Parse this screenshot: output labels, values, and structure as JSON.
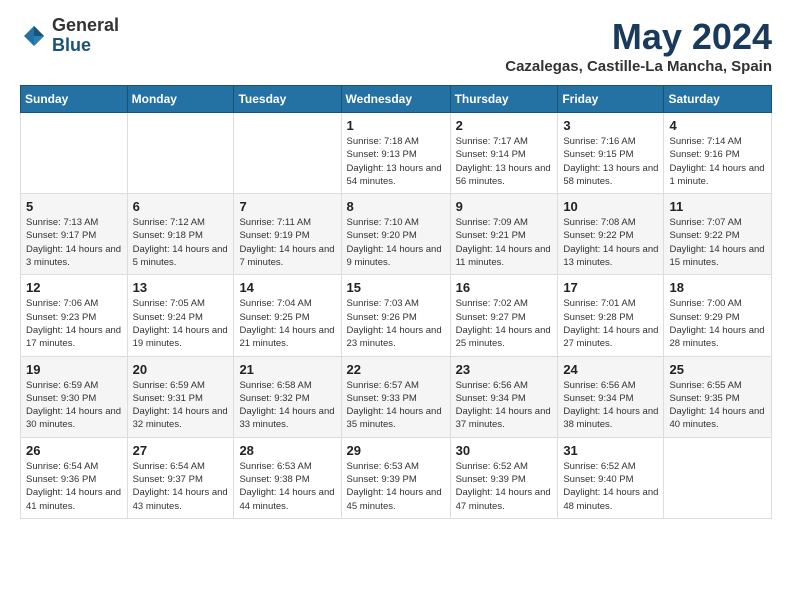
{
  "logo": {
    "general": "General",
    "blue": "Blue"
  },
  "title": "May 2024",
  "subtitle": "Cazalegas, Castille-La Mancha, Spain",
  "days_of_week": [
    "Sunday",
    "Monday",
    "Tuesday",
    "Wednesday",
    "Thursday",
    "Friday",
    "Saturday"
  ],
  "weeks": [
    [
      {
        "day": "",
        "info": ""
      },
      {
        "day": "",
        "info": ""
      },
      {
        "day": "",
        "info": ""
      },
      {
        "day": "1",
        "info": "Sunrise: 7:18 AM\nSunset: 9:13 PM\nDaylight: 13 hours and 54 minutes."
      },
      {
        "day": "2",
        "info": "Sunrise: 7:17 AM\nSunset: 9:14 PM\nDaylight: 13 hours and 56 minutes."
      },
      {
        "day": "3",
        "info": "Sunrise: 7:16 AM\nSunset: 9:15 PM\nDaylight: 13 hours and 58 minutes."
      },
      {
        "day": "4",
        "info": "Sunrise: 7:14 AM\nSunset: 9:16 PM\nDaylight: 14 hours and 1 minute."
      }
    ],
    [
      {
        "day": "5",
        "info": "Sunrise: 7:13 AM\nSunset: 9:17 PM\nDaylight: 14 hours and 3 minutes."
      },
      {
        "day": "6",
        "info": "Sunrise: 7:12 AM\nSunset: 9:18 PM\nDaylight: 14 hours and 5 minutes."
      },
      {
        "day": "7",
        "info": "Sunrise: 7:11 AM\nSunset: 9:19 PM\nDaylight: 14 hours and 7 minutes."
      },
      {
        "day": "8",
        "info": "Sunrise: 7:10 AM\nSunset: 9:20 PM\nDaylight: 14 hours and 9 minutes."
      },
      {
        "day": "9",
        "info": "Sunrise: 7:09 AM\nSunset: 9:21 PM\nDaylight: 14 hours and 11 minutes."
      },
      {
        "day": "10",
        "info": "Sunrise: 7:08 AM\nSunset: 9:22 PM\nDaylight: 14 hours and 13 minutes."
      },
      {
        "day": "11",
        "info": "Sunrise: 7:07 AM\nSunset: 9:22 PM\nDaylight: 14 hours and 15 minutes."
      }
    ],
    [
      {
        "day": "12",
        "info": "Sunrise: 7:06 AM\nSunset: 9:23 PM\nDaylight: 14 hours and 17 minutes."
      },
      {
        "day": "13",
        "info": "Sunrise: 7:05 AM\nSunset: 9:24 PM\nDaylight: 14 hours and 19 minutes."
      },
      {
        "day": "14",
        "info": "Sunrise: 7:04 AM\nSunset: 9:25 PM\nDaylight: 14 hours and 21 minutes."
      },
      {
        "day": "15",
        "info": "Sunrise: 7:03 AM\nSunset: 9:26 PM\nDaylight: 14 hours and 23 minutes."
      },
      {
        "day": "16",
        "info": "Sunrise: 7:02 AM\nSunset: 9:27 PM\nDaylight: 14 hours and 25 minutes."
      },
      {
        "day": "17",
        "info": "Sunrise: 7:01 AM\nSunset: 9:28 PM\nDaylight: 14 hours and 27 minutes."
      },
      {
        "day": "18",
        "info": "Sunrise: 7:00 AM\nSunset: 9:29 PM\nDaylight: 14 hours and 28 minutes."
      }
    ],
    [
      {
        "day": "19",
        "info": "Sunrise: 6:59 AM\nSunset: 9:30 PM\nDaylight: 14 hours and 30 minutes."
      },
      {
        "day": "20",
        "info": "Sunrise: 6:59 AM\nSunset: 9:31 PM\nDaylight: 14 hours and 32 minutes."
      },
      {
        "day": "21",
        "info": "Sunrise: 6:58 AM\nSunset: 9:32 PM\nDaylight: 14 hours and 33 minutes."
      },
      {
        "day": "22",
        "info": "Sunrise: 6:57 AM\nSunset: 9:33 PM\nDaylight: 14 hours and 35 minutes."
      },
      {
        "day": "23",
        "info": "Sunrise: 6:56 AM\nSunset: 9:34 PM\nDaylight: 14 hours and 37 minutes."
      },
      {
        "day": "24",
        "info": "Sunrise: 6:56 AM\nSunset: 9:34 PM\nDaylight: 14 hours and 38 minutes."
      },
      {
        "day": "25",
        "info": "Sunrise: 6:55 AM\nSunset: 9:35 PM\nDaylight: 14 hours and 40 minutes."
      }
    ],
    [
      {
        "day": "26",
        "info": "Sunrise: 6:54 AM\nSunset: 9:36 PM\nDaylight: 14 hours and 41 minutes."
      },
      {
        "day": "27",
        "info": "Sunrise: 6:54 AM\nSunset: 9:37 PM\nDaylight: 14 hours and 43 minutes."
      },
      {
        "day": "28",
        "info": "Sunrise: 6:53 AM\nSunset: 9:38 PM\nDaylight: 14 hours and 44 minutes."
      },
      {
        "day": "29",
        "info": "Sunrise: 6:53 AM\nSunset: 9:39 PM\nDaylight: 14 hours and 45 minutes."
      },
      {
        "day": "30",
        "info": "Sunrise: 6:52 AM\nSunset: 9:39 PM\nDaylight: 14 hours and 47 minutes."
      },
      {
        "day": "31",
        "info": "Sunrise: 6:52 AM\nSunset: 9:40 PM\nDaylight: 14 hours and 48 minutes."
      },
      {
        "day": "",
        "info": ""
      }
    ]
  ]
}
